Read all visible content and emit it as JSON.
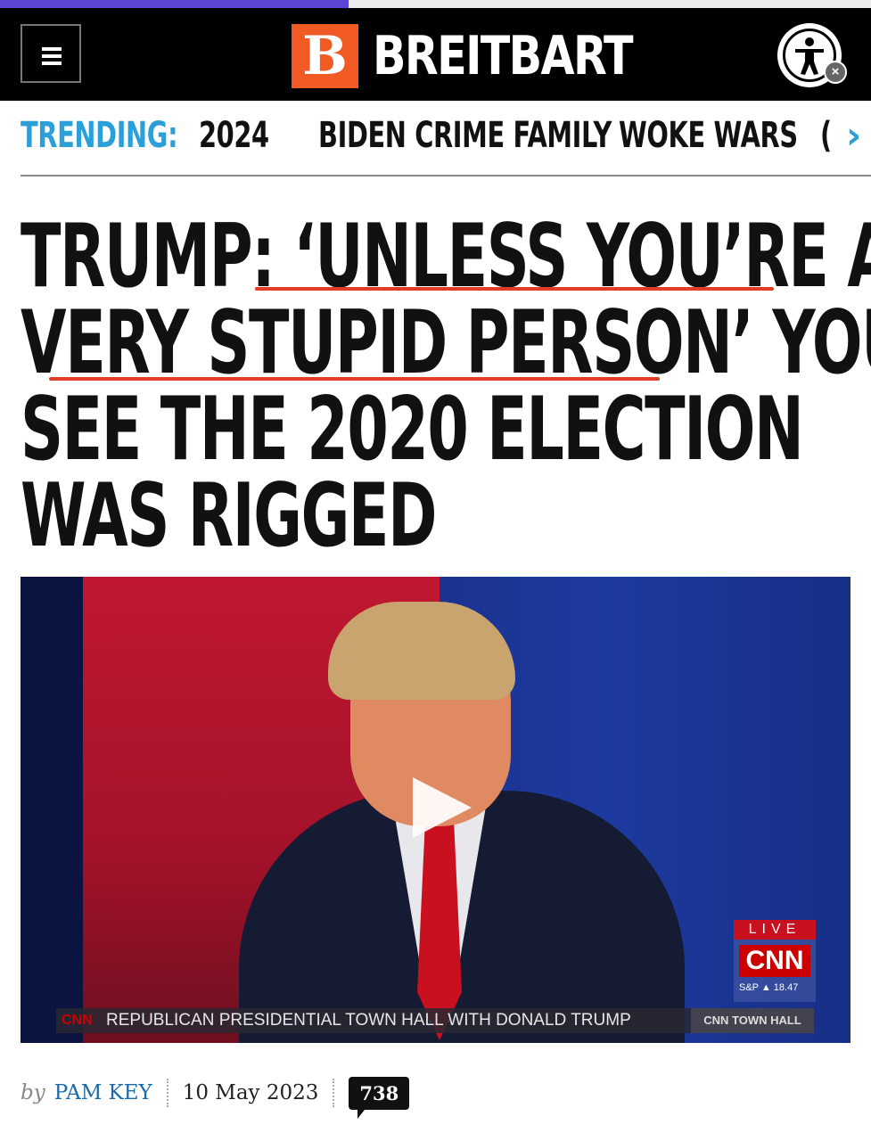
{
  "reading_progress": 0.4,
  "header": {
    "menu_icon": "hamburger-menu-icon",
    "logo_letter": "B",
    "logo_text": "BREITBART",
    "accessibility_icon": "accessibility-person-icon",
    "accessibility_close_icon": "close-icon",
    "accessibility_close_glyph": "×",
    "colors": {
      "background": "#000000",
      "logo_accent": "#f15a22"
    }
  },
  "trending": {
    "label": "TRENDING:",
    "items": [
      "2024",
      "BIDEN CRIME FAMILY",
      "WOKE WARS",
      "("
    ],
    "next_glyph": "›",
    "next_icon": "chevron-right-icon",
    "colors": {
      "label": "#2ba0d8"
    }
  },
  "article": {
    "headline_lines": [
      "TRUMP: ‘UNLESS YOU’RE A",
      "VERY STUPID PERSON’ YOU",
      "SEE THE 2020 ELECTION",
      "WAS RIGGED"
    ],
    "highlight_color": "#e23d26",
    "video": {
      "play_icon": "play-icon",
      "live_label": "LIVE",
      "network_logo": "CNN",
      "ticker": "S&P ▲ 18.47",
      "lower_third_logo": "CNN",
      "lower_third_title": "REPUBLICAN PRESIDENTIAL TOWN HALL WITH DONALD TRUMP",
      "lower_third_tag": "CNN TOWN HALL"
    },
    "byline": {
      "by": "by",
      "author": "PAM KEY",
      "date": "10 May 2023",
      "comment_count": "738"
    }
  }
}
